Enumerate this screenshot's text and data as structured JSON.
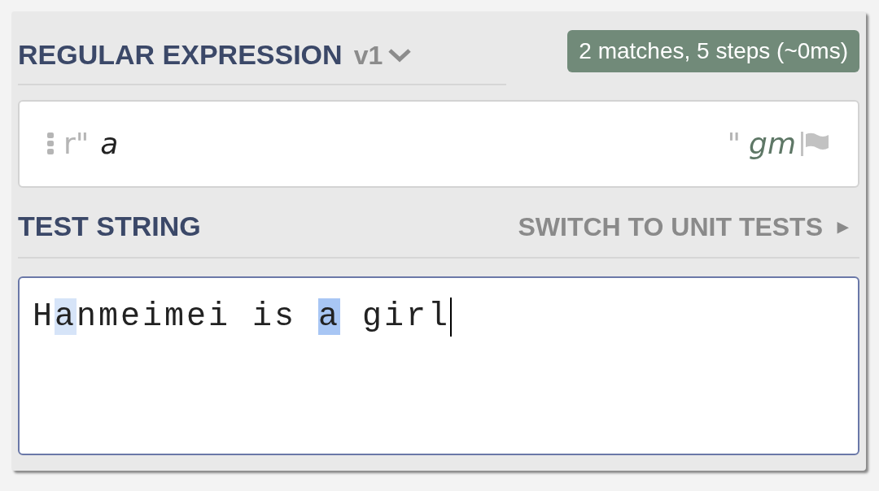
{
  "regex_section": {
    "title": "REGULAR EXPRESSION",
    "version": "v1",
    "match_info": "2 matches, 5 steps (~0ms)"
  },
  "regex_field": {
    "prefix": "r\"",
    "value": "a",
    "suffix": "\"",
    "flags": "gm"
  },
  "test_section": {
    "title": "TEST STRING",
    "switch_link": "SWITCH TO UNIT TESTS",
    "switch_arrow": "▸"
  },
  "test_string": {
    "segments": [
      {
        "text": "H",
        "match": false
      },
      {
        "text": "a",
        "match": true,
        "color": "#d6e4f8"
      },
      {
        "text": "nmeimei is ",
        "match": false
      },
      {
        "text": "a",
        "match": true,
        "color": "#a8c6f4"
      },
      {
        "text": " girl",
        "match": false
      }
    ],
    "focused": true
  }
}
